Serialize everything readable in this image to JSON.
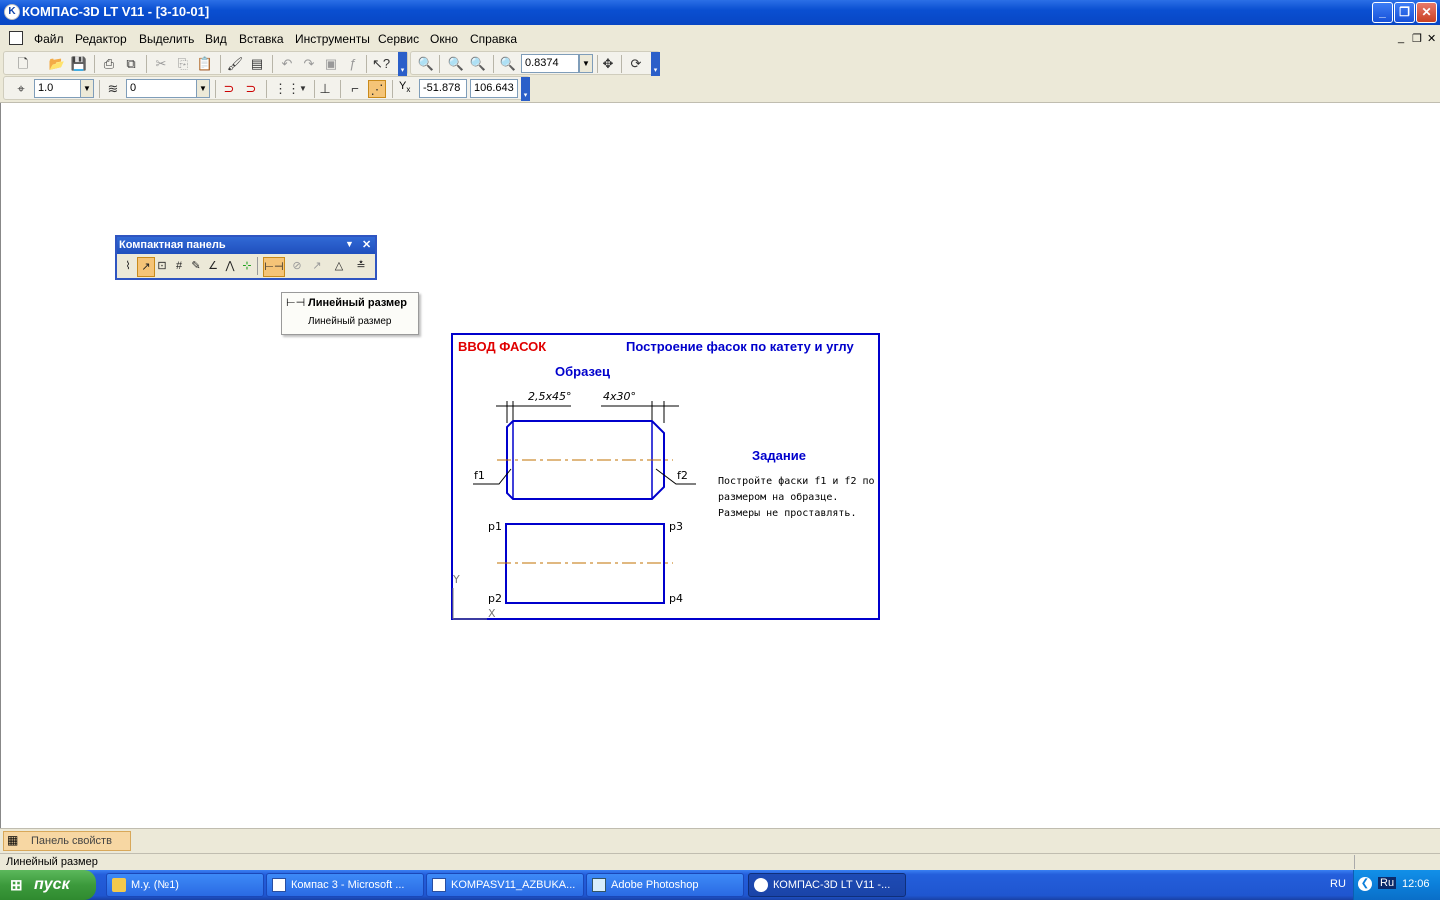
{
  "window": {
    "title": "КОМПАС-3D LT V11 - [3-10-01]",
    "icon_name": "kompas-logo-icon",
    "min": "_",
    "max": "❐",
    "close": "✕"
  },
  "menu": {
    "items": [
      "Файл",
      "Редактор",
      "Выделить",
      "Вид",
      "Вставка",
      "Инструменты",
      "Сервис",
      "Окно",
      "Справка"
    ],
    "mdi_controls": [
      "_",
      "❐",
      "✕"
    ]
  },
  "toolbar1": {
    "zoom_value": "0.8374"
  },
  "toolbar2": {
    "step_value": "1.0",
    "layer_value": "0",
    "coord_label": "Y",
    "coord_sub": "x",
    "x_value": "-51.878",
    "y_value": "106.643"
  },
  "compact_panel": {
    "title": "Компактная панель",
    "menu_glyph": "▼",
    "close_glyph": "✕",
    "icons": [
      "geometry-icon",
      "edit-icon",
      "dimension-sizes-icon",
      "hatch-icon",
      "fragment-icon",
      "measure-icon",
      "symbols-icon",
      "parametrization-icon",
      "linear-dimension-icon",
      "diameter-dimension-icon",
      "radial-dimension-icon",
      "angular-dimension-icon",
      "auto-line-icon"
    ]
  },
  "flyout": {
    "title": "Линейный размер",
    "subtitle": "Линейный размер"
  },
  "drawing": {
    "title_left": "ВВОД ФАСОК",
    "title_right": "Построение фасок по катету и углу",
    "sample_label": "Образец",
    "dim_left": "2,5х45°",
    "dim_right": "4х30°",
    "label_f1": "f1",
    "label_f2": "f2",
    "task_title": "Задание",
    "task_lines": [
      "Постройте фаски f1 и f2 по",
      "размером на образце.",
      "Размеры не проставлять."
    ],
    "p1": "p1",
    "p2": "p2",
    "p3": "p3",
    "p4": "p4",
    "axis_y": "Y",
    "axis_x": "X",
    "colors": {
      "frame": "#0000cc",
      "title_red": "#e00000",
      "centerline": "#c07000"
    }
  },
  "props_panel": {
    "label": "Панель свойств"
  },
  "status": {
    "text": "Линейный размер"
  },
  "taskbar": {
    "start_label": "пуск",
    "tasks": [
      {
        "label": "М.у. (№1)",
        "icon": "folder-icon"
      },
      {
        "label": "Компас 3 - Microsoft ...",
        "icon": "word-icon"
      },
      {
        "label": "KOMPASV11_AZBUKA...",
        "icon": "word-icon"
      },
      {
        "label": "Adobe Photoshop",
        "icon": "photoshop-icon"
      },
      {
        "label": "КОМПАС-3D LT V11 -...",
        "icon": "kompas-icon"
      }
    ],
    "lang": "RU",
    "input_lang": "Ru",
    "clock": "12:06"
  }
}
